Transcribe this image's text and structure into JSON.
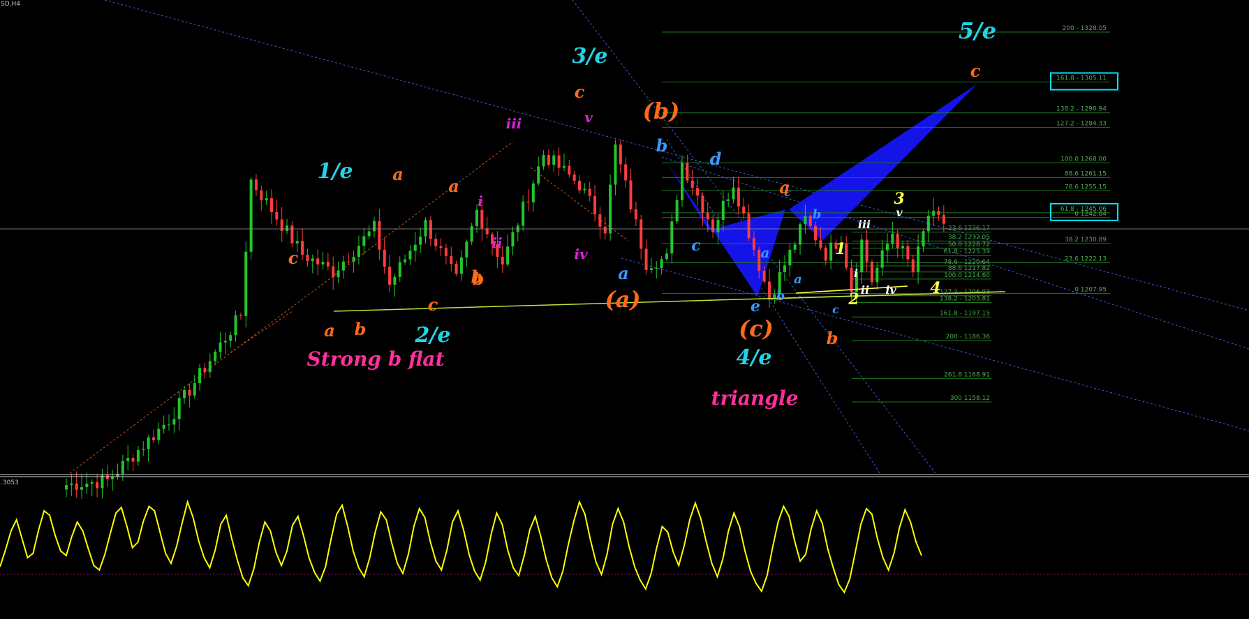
{
  "window": {
    "symbol_label": "SD,H4",
    "oscillator_label": ".3053"
  },
  "colors": {
    "background": "#000000",
    "bull_candle": "#22c52b",
    "bear_candle": "#ff3c3c",
    "pattern_fill": "#1515f5",
    "fib_line": "#1f7a1f",
    "fib_text": "#4faa4f",
    "support_line": "#b9e33a",
    "oscillator": "#ffff00",
    "trend_line": "#3b5bd6",
    "channel_line": "#c8581a",
    "highlight_box": "#00e5ff"
  },
  "chart_data": {
    "type": "candlestick",
    "instrument_label": "SD,H4",
    "fib_levels_right": [
      {
        "label": "200 - 1328.05",
        "price": 1328.05
      },
      {
        "label": "161.8 - 1305.11",
        "price": 1305.11,
        "boxed": true
      },
      {
        "label": "138.2 - 1290.94",
        "price": 1290.94
      },
      {
        "label": "127.2 - 1284.33",
        "price": 1284.33
      },
      {
        "label": "100.0 1268.00",
        "price": 1268.0
      },
      {
        "label": "88.6 1261.15",
        "price": 1261.15
      },
      {
        "label": "78.6 1255.15",
        "price": 1255.15
      },
      {
        "label": "61.8 - 1245.06",
        "price": 1245.06,
        "boxed": true
      },
      {
        "label": "0 1242.84",
        "price": 1242.84
      },
      {
        "label": "38.2 1230.89",
        "price": 1230.89
      },
      {
        "label": "23.6 1222.13",
        "price": 1222.13
      },
      {
        "label": "0 1207.95",
        "price": 1207.95
      }
    ],
    "fib_levels_mid": [
      {
        "label": "23.6 1236.17",
        "price": 1236.17
      },
      {
        "label": "38.2 1232.05",
        "price": 1232.05
      },
      {
        "label": "50.0 1228.72",
        "price": 1228.72
      },
      {
        "label": "61.8 - 1225.39",
        "price": 1225.39
      },
      {
        "label": "78.6 - 1220.64",
        "price": 1220.64
      },
      {
        "label": "88.6 1217.82",
        "price": 1217.82
      },
      {
        "label": "100.0 1214.60",
        "price": 1214.6
      },
      {
        "label": "127.2 - 1206.93",
        "price": 1206.93
      },
      {
        "label": "138.2 - 1203.81",
        "price": 1203.81
      },
      {
        "label": "161.8 - 1197.15",
        "price": 1197.15
      },
      {
        "label": "200 - 1186.36",
        "price": 1186.36
      },
      {
        "label": "261.8 1168.91",
        "price": 1168.91
      },
      {
        "label": "300 1158.12",
        "price": 1158.12
      }
    ],
    "wave_labels": [
      {
        "text": "1/e",
        "color": "#22d3e6",
        "size": 30,
        "idx": 60
      },
      {
        "text": "c",
        "color": "#ff6a1a",
        "size": 24,
        "idx": 60
      },
      {
        "text": "a",
        "color": "#ff6a1a",
        "size": 24,
        "idx": 46
      },
      {
        "text": "b",
        "color": "#ff6a1a",
        "size": 24,
        "idx": 58
      },
      {
        "text": "a",
        "color": "#ff6a1a",
        "size": 24,
        "idx": 63
      },
      {
        "text": "b",
        "color": "#ff6a1a",
        "size": 24,
        "idx": 70
      },
      {
        "text": "c",
        "color": "#ff6a1a",
        "size": 24,
        "idx": 76
      },
      {
        "text": "2/e",
        "color": "#22d3e6",
        "size": 30,
        "idx": 76
      },
      {
        "text": "Strong b flat",
        "color": "#ff2f9c",
        "size": 28,
        "idx": 78
      },
      {
        "text": "a",
        "color": "#ff6a1a",
        "size": 24,
        "idx": 80
      },
      {
        "text": "b",
        "color": "#ff6a1a",
        "size": 24,
        "idx": 85
      },
      {
        "text": "i",
        "color": "#e21cde",
        "size": 20,
        "idx": 87
      },
      {
        "text": "ii",
        "color": "#e21cde",
        "size": 20,
        "idx": 89
      },
      {
        "text": "iii",
        "color": "#e21cde",
        "size": 20,
        "idx": 93
      },
      {
        "text": "iv",
        "color": "#e21cde",
        "size": 20,
        "idx": 105
      },
      {
        "text": "v",
        "color": "#e21cde",
        "size": 20,
        "idx": 106
      },
      {
        "text": "3/e",
        "color": "#22d3e6",
        "size": 30,
        "idx": 107
      },
      {
        "text": "c",
        "color": "#ff6a1a",
        "size": 24,
        "idx": 107
      },
      {
        "text": "a",
        "color": "#3a97ff",
        "size": 24,
        "idx": 113
      },
      {
        "text": "(a)",
        "color": "#ff6a1a",
        "size": 32,
        "idx": 113
      },
      {
        "text": "(b)",
        "color": "#ff6a1a",
        "size": 32,
        "idx": 120
      },
      {
        "text": "b",
        "color": "#3a97ff",
        "size": 24,
        "idx": 120
      },
      {
        "text": "c",
        "color": "#3a97ff",
        "size": 22,
        "idx": 126
      },
      {
        "text": "d",
        "color": "#3a97ff",
        "size": 24,
        "idx": 130
      },
      {
        "text": "e",
        "color": "#3a97ff",
        "size": 22,
        "idx": 137
      },
      {
        "text": "(c)",
        "color": "#ff6a1a",
        "size": 32,
        "idx": 137
      },
      {
        "text": "4/e",
        "color": "#22d3e6",
        "size": 30,
        "idx": 137
      },
      {
        "text": "triangle",
        "color": "#ff2f9c",
        "size": 28,
        "idx": 137
      },
      {
        "text": "a",
        "color": "#3a97ff",
        "size": 20,
        "idx": 139
      },
      {
        "text": "b",
        "color": "#3a97ff",
        "size": 18,
        "idx": 142
      },
      {
        "text": "a",
        "color": "#3a97ff",
        "size": 18,
        "idx": 145
      },
      {
        "text": "c",
        "color": "#3a97ff",
        "size": 16,
        "idx": 144
      },
      {
        "text": "b",
        "color": "#3a97ff",
        "size": 18,
        "idx": 148
      },
      {
        "text": "a",
        "color": "#ff6a1a",
        "size": 24,
        "idx": 144
      },
      {
        "text": "b",
        "color": "#ff6a1a",
        "size": 24,
        "idx": 153
      },
      {
        "text": "c",
        "color": "#3a97ff",
        "size": 16,
        "idx": 153
      },
      {
        "text": "1",
        "color": "#ffff40",
        "size": 22,
        "idx": 154
      },
      {
        "text": "2",
        "color": "#ffff40",
        "size": 22,
        "idx": 157
      },
      {
        "text": "i",
        "color": "#ffffff",
        "size": 16,
        "idx": 158
      },
      {
        "text": "ii",
        "color": "#ffffff",
        "size": 16,
        "idx": 160
      },
      {
        "text": "iii",
        "color": "#ffffff",
        "size": 16,
        "idx": 161
      },
      {
        "text": "iv",
        "color": "#ffffff",
        "size": 16,
        "idx": 165
      },
      {
        "text": "4",
        "color": "#ffff40",
        "size": 22,
        "idx": 171
      },
      {
        "text": "3",
        "color": "#ffff40",
        "size": 22,
        "idx": 166
      },
      {
        "text": "v",
        "color": "#ffffff",
        "size": 16,
        "idx": 166
      },
      {
        "text": "c",
        "color": "#ff6a1a",
        "size": 24,
        "idx": 180
      },
      {
        "text": "5/e",
        "color": "#22d3e6",
        "size": 32,
        "idx": 180
      }
    ],
    "oscillator_values": [
      0.3,
      0.45,
      0.62,
      0.72,
      0.55,
      0.38,
      0.42,
      0.63,
      0.8,
      0.76,
      0.58,
      0.44,
      0.4,
      0.57,
      0.7,
      0.62,
      0.46,
      0.31,
      0.27,
      0.41,
      0.6,
      0.78,
      0.83,
      0.66,
      0.47,
      0.52,
      0.71,
      0.84,
      0.8,
      0.61,
      0.42,
      0.33,
      0.48,
      0.69,
      0.88,
      0.74,
      0.53,
      0.38,
      0.29,
      0.45,
      0.68,
      0.76,
      0.55,
      0.36,
      0.2,
      0.13,
      0.28,
      0.52,
      0.7,
      0.62,
      0.43,
      0.31,
      0.44,
      0.67,
      0.75,
      0.58,
      0.38,
      0.25,
      0.17,
      0.3,
      0.55,
      0.77,
      0.85,
      0.66,
      0.44,
      0.29,
      0.21,
      0.38,
      0.61,
      0.79,
      0.72,
      0.51,
      0.33,
      0.24,
      0.41,
      0.66,
      0.82,
      0.74,
      0.52,
      0.35,
      0.27,
      0.45,
      0.7,
      0.8,
      0.63,
      0.41,
      0.26,
      0.18,
      0.34,
      0.59,
      0.78,
      0.68,
      0.45,
      0.29,
      0.22,
      0.4,
      0.63,
      0.75,
      0.57,
      0.36,
      0.2,
      0.12,
      0.26,
      0.5,
      0.71,
      0.88,
      0.77,
      0.54,
      0.34,
      0.23,
      0.41,
      0.68,
      0.82,
      0.7,
      0.48,
      0.3,
      0.18,
      0.1,
      0.24,
      0.47,
      0.66,
      0.61,
      0.43,
      0.31,
      0.49,
      0.72,
      0.87,
      0.73,
      0.52,
      0.33,
      0.21,
      0.37,
      0.62,
      0.78,
      0.66,
      0.44,
      0.26,
      0.15,
      0.08,
      0.22,
      0.47,
      0.7,
      0.84,
      0.75,
      0.53,
      0.35,
      0.41,
      0.64,
      0.8,
      0.69,
      0.46,
      0.29,
      0.14,
      0.07,
      0.19,
      0.43,
      0.68,
      0.82,
      0.77,
      0.55,
      0.38,
      0.27,
      0.42,
      0.65,
      0.81,
      0.7,
      0.52,
      0.4
    ],
    "oscillator_bounds": [
      0,
      1
    ],
    "series_note": "candlestick series reproduced procedurally from pivots",
    "pivots": [
      {
        "i": 0,
        "p": 1120
      },
      {
        "i": 8,
        "p": 1122
      },
      {
        "i": 20,
        "p": 1150
      },
      {
        "i": 34,
        "p": 1198
      },
      {
        "i": 36,
        "p": 1260
      },
      {
        "i": 46,
        "p": 1226
      },
      {
        "i": 52,
        "p": 1218
      },
      {
        "i": 60,
        "p": 1238
      },
      {
        "i": 63,
        "p": 1212
      },
      {
        "i": 70,
        "p": 1240
      },
      {
        "i": 76,
        "p": 1214
      },
      {
        "i": 80,
        "p": 1246
      },
      {
        "i": 85,
        "p": 1222
      },
      {
        "i": 93,
        "p": 1272
      },
      {
        "i": 100,
        "p": 1258
      },
      {
        "i": 105,
        "p": 1238
      },
      {
        "i": 107,
        "p": 1275
      },
      {
        "i": 113,
        "p": 1222
      },
      {
        "i": 117,
        "p": 1224
      },
      {
        "i": 120,
        "p": 1268
      },
      {
        "i": 126,
        "p": 1238
      },
      {
        "i": 130,
        "p": 1259
      },
      {
        "i": 137,
        "p": 1206
      },
      {
        "i": 139,
        "p": 1216
      },
      {
        "i": 144,
        "p": 1242
      },
      {
        "i": 148,
        "p": 1226
      },
      {
        "i": 151,
        "p": 1234
      },
      {
        "i": 153,
        "p": 1210
      },
      {
        "i": 155,
        "p": 1232
      },
      {
        "i": 157,
        "p": 1214
      },
      {
        "i": 161,
        "p": 1236
      },
      {
        "i": 165,
        "p": 1218
      },
      {
        "i": 168,
        "p": 1244
      },
      {
        "i": 171,
        "p": 1240
      }
    ]
  }
}
